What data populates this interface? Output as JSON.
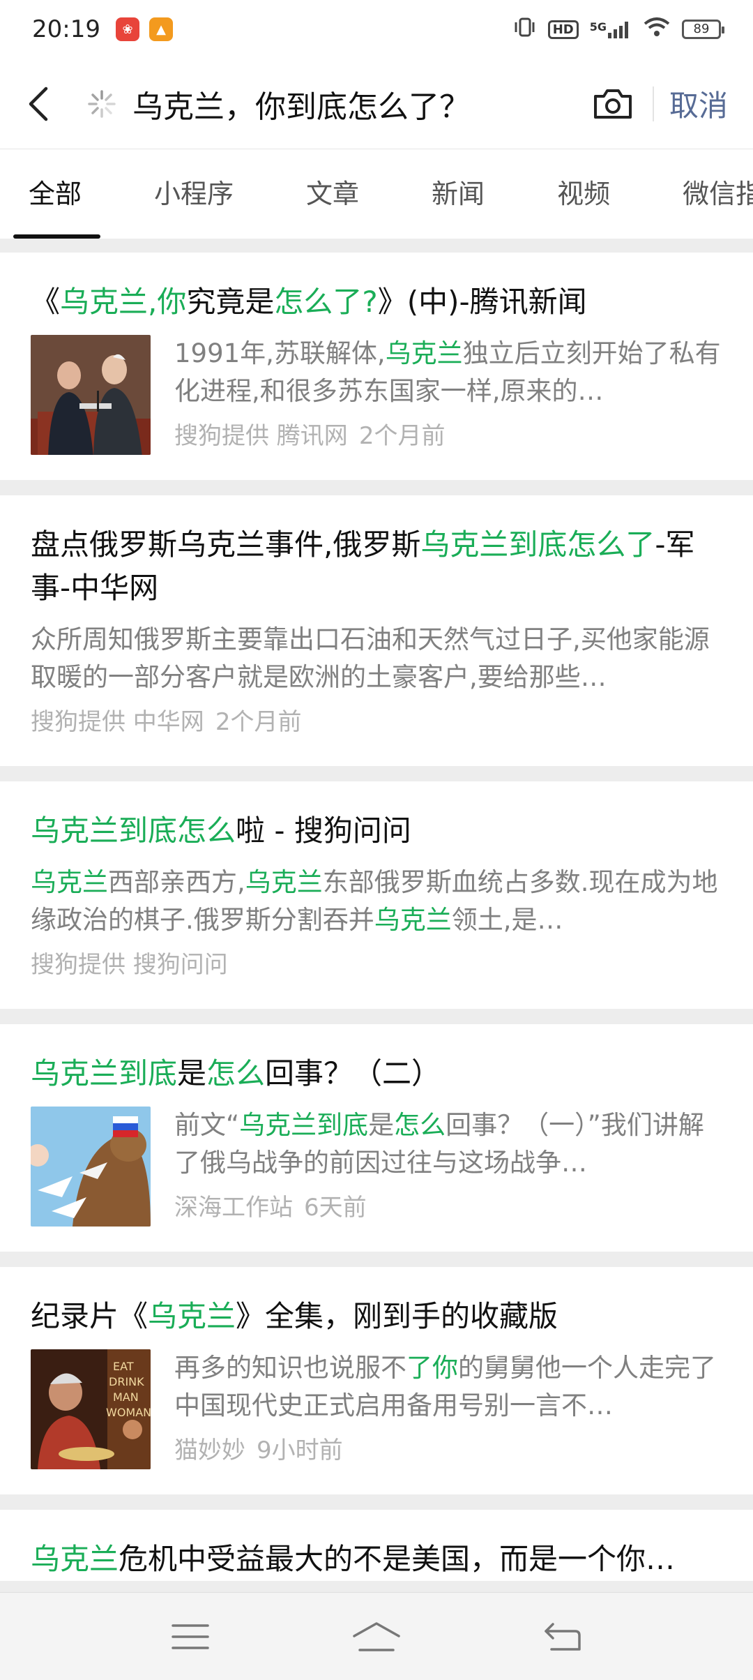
{
  "status_bar": {
    "time": "20:19",
    "network": "5G",
    "battery": "89",
    "hd": "HD"
  },
  "search": {
    "query": "乌克兰，你到底怎么了？",
    "cancel_label": "取消"
  },
  "tabs": [
    {
      "label": "全部",
      "active": true
    },
    {
      "label": "小程序"
    },
    {
      "label": "文章"
    },
    {
      "label": "新闻"
    },
    {
      "label": "视频"
    },
    {
      "label": "微信指"
    }
  ],
  "results": [
    {
      "title": [
        "《",
        "乌克兰,你",
        "究竟是",
        "怎么了?",
        "》(中)-腾讯新闻"
      ],
      "snippet": [
        "1991年,苏联解体,",
        "乌克兰",
        "独立后立刻开始了私有化进程,和很多苏东国家一样,原来的…"
      ],
      "meta": [
        "搜狗提供 腾讯网",
        "2个月前"
      ],
      "thumb": "photo-politicians"
    },
    {
      "title": [
        "盘点俄罗斯乌克兰事件,俄罗斯",
        "乌克兰到底怎么了",
        "-军事-中华网"
      ],
      "snippet": [
        "众所周知俄罗斯主要靠出口石油和天然气过日子,买他家能源取暖的一部分客户就是欧洲的土豪客户,要给那些…"
      ],
      "meta": [
        "搜狗提供 中华网",
        "2个月前"
      ]
    },
    {
      "title": [
        "乌克兰到底怎么",
        "啦 - 搜狗问问"
      ],
      "snippet": [
        "乌克兰",
        "西部亲西方,",
        "乌克兰",
        "东部俄罗斯血统占多数.现在成为地缘政治的棋子.俄罗斯分割吞并",
        "乌克兰",
        "领土,是…"
      ],
      "meta": [
        "搜狗提供 搜狗问问"
      ]
    },
    {
      "title": [
        "乌克兰到底",
        "是",
        "怎么",
        "回事？（二）"
      ],
      "snippet": [
        "前文“",
        "乌克兰到底",
        "是",
        "怎么",
        "回事？（一）”我们讲解了俄乌战争的前因过往与这场战争…"
      ],
      "meta": [
        "深海工作站",
        "6天前"
      ],
      "thumb": "cartoon-bear"
    },
    {
      "title": [
        "纪录片《",
        "乌克兰",
        "》全集，刚到手的收藏版"
      ],
      "snippet": [
        "再多的知识也说服不",
        "了你",
        "的舅舅他一个人走完了中国现代史正式启用备用号别一言不…"
      ],
      "meta": [
        "猫妙妙",
        "9小时前"
      ],
      "thumb": "photo-movie"
    },
    {
      "title": [
        "乌克兰",
        "危机中受益最大的不是美国，而是一个你…"
      ]
    }
  ],
  "colors": {
    "highlight": "#1aad57",
    "link": "#576b95",
    "meta": "#b2b2b2"
  }
}
